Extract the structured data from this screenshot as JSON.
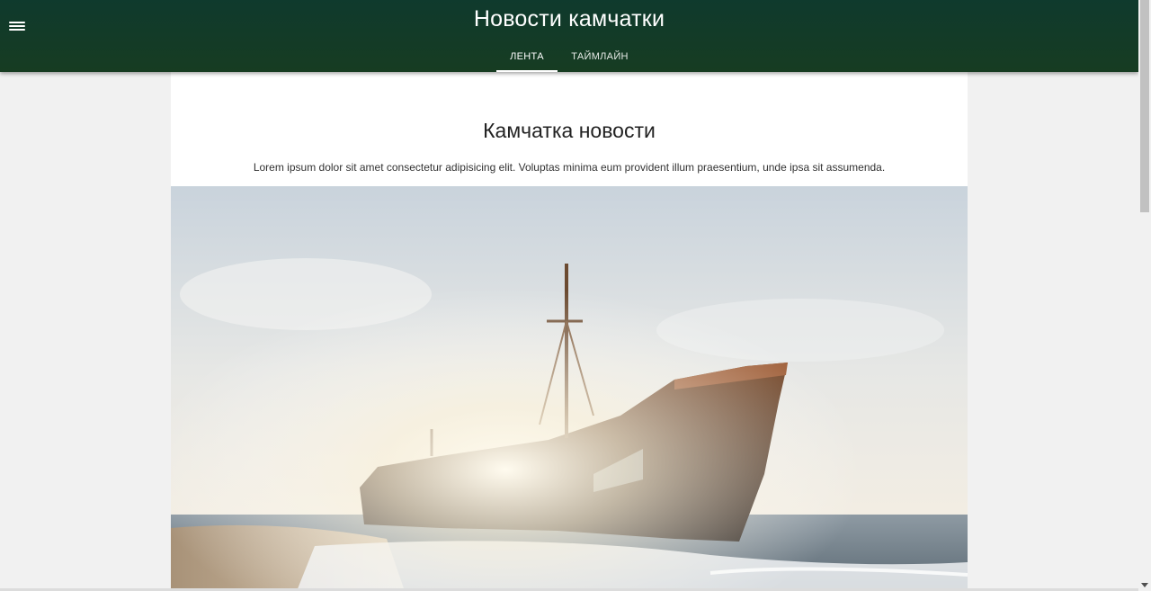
{
  "header": {
    "title": "Новости камчатки",
    "menu_icon": "hamburger-menu-icon",
    "tabs": [
      {
        "label": "ЛЕНТА",
        "active": true
      },
      {
        "label": "ТАЙМЛАЙН",
        "active": false
      }
    ]
  },
  "article": {
    "title": "Камчатка новости",
    "text": "Lorem ipsum dolor sit amet consectetur adipisicing elit. Voluptas minima eum provident illum praesentium, unde ipsa sit assumenda."
  },
  "colors": {
    "header_top": "#0f3a2d",
    "header_bottom": "#173c22",
    "page_background": "#f1f1f1",
    "card_background": "#ffffff"
  }
}
